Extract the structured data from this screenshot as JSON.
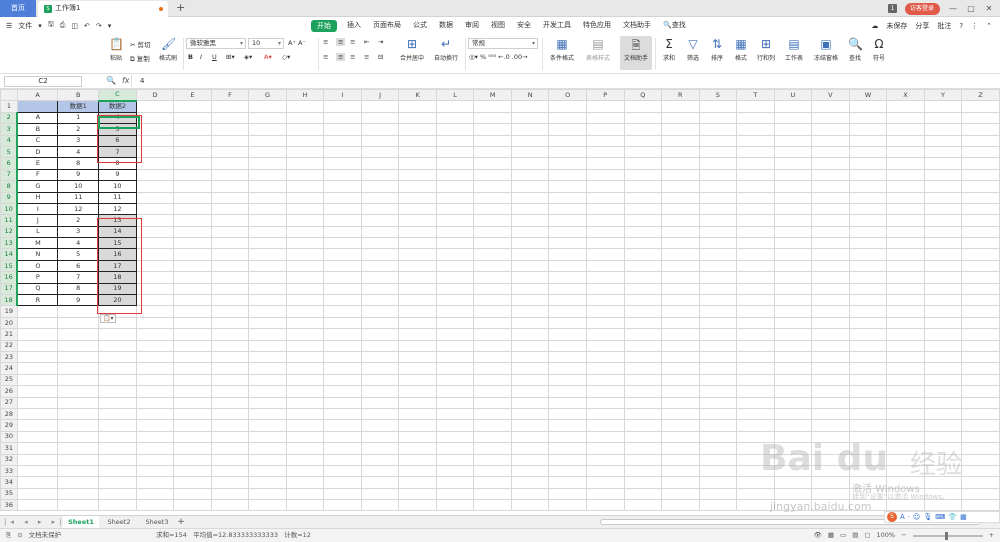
{
  "titlebar": {
    "home_tab": "首页",
    "doc_tab": "工作簿1",
    "doc_icon": "S",
    "new_tab": "+",
    "badge": "1",
    "login": "访客登录",
    "minimize": "—",
    "restore": "▢",
    "close": "✕"
  },
  "menubar": {
    "file": "文件",
    "tabs": [
      "开始",
      "插入",
      "页面布局",
      "公式",
      "数据",
      "审阅",
      "视图",
      "安全",
      "开发工具",
      "特色应用",
      "文档助手"
    ],
    "search": "查找",
    "unsaved": "未保存",
    "share": "分享",
    "comment": "批注"
  },
  "ribbon": {
    "paste": "粘贴",
    "cut": "剪切",
    "copy": "复制",
    "format_painter": "格式刷",
    "font_name": "微软雅黑",
    "font_size": "10",
    "merge_center": "合并居中",
    "wrap_text": "自动换行",
    "number_format": "常规",
    "conditional_format": "条件格式",
    "table_style": "表格样式",
    "doc_assistant": "文档助手",
    "sum": "求和",
    "filter": "筛选",
    "sort": "排序",
    "format": "格式",
    "rows_cols": "行和列",
    "worksheet": "工作表",
    "freeze": "冻结窗格",
    "find": "查找",
    "symbol": "符号"
  },
  "formula_bar": {
    "cell_ref": "C2",
    "fx": "fx",
    "value": "4"
  },
  "columns": [
    "A",
    "B",
    "C",
    "D",
    "E",
    "F",
    "G",
    "H",
    "I",
    "J",
    "K",
    "L",
    "M",
    "N",
    "O",
    "P",
    "Q",
    "R",
    "S",
    "T",
    "U",
    "V",
    "W",
    "X",
    "Y",
    "Z"
  ],
  "table": {
    "headers": [
      "",
      "数据1",
      "数据2"
    ],
    "rows": [
      [
        "A",
        "1",
        "4"
      ],
      [
        "B",
        "2",
        "5"
      ],
      [
        "C",
        "3",
        "6"
      ],
      [
        "D",
        "4",
        "7"
      ],
      [
        "E",
        "8",
        "8"
      ],
      [
        "F",
        "9",
        "9"
      ],
      [
        "G",
        "10",
        "10"
      ],
      [
        "H",
        "11",
        "11"
      ],
      [
        "I",
        "12",
        "12"
      ],
      [
        "J",
        "2",
        "13"
      ],
      [
        "L",
        "3",
        "14"
      ],
      [
        "M",
        "4",
        "15"
      ],
      [
        "N",
        "5",
        "16"
      ],
      [
        "O",
        "6",
        "17"
      ],
      [
        "P",
        "7",
        "18"
      ],
      [
        "Q",
        "8",
        "19"
      ],
      [
        "R",
        "9",
        "20"
      ]
    ]
  },
  "sheets": [
    "Sheet1",
    "Sheet2",
    "Sheet3"
  ],
  "add_sheet": "+",
  "status": {
    "protect": "文档未保护",
    "sum": "求和=154",
    "average": "平均值=12.833333333333",
    "count": "计数=12",
    "zoom": "100%"
  },
  "watermark": {
    "brand": "Bai du",
    "cn": "经验",
    "activate": "激活 Windows",
    "activate_sub": "转到“设置”以激活 Windows。",
    "url": "jingyan.baidu.com"
  },
  "ime": {
    "logo": "S",
    "lang": "A"
  },
  "colors": {
    "accent": "#1da25e",
    "header_fill": "#b4c6e7",
    "highlight_box": "#e03a3a",
    "selected_fill": "#d9d9d9"
  }
}
